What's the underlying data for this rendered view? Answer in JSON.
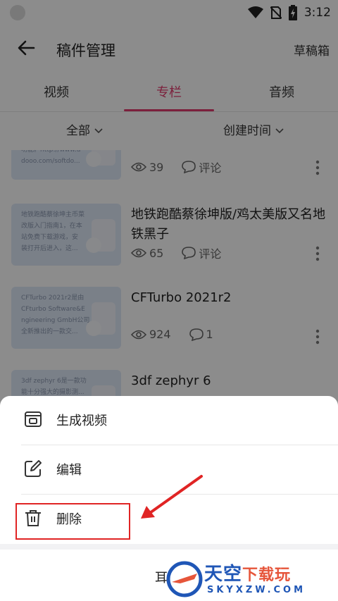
{
  "status_bar": {
    "time": "3:12"
  },
  "header": {
    "title": "稿件管理",
    "drafts_label": "草稿箱"
  },
  "tabs": [
    {
      "label": "视频",
      "active": false
    },
    {
      "label": "专栏",
      "active": true
    },
    {
      "label": "音频",
      "active": false
    }
  ],
  "filters": {
    "all_label": "全部",
    "sort_label": "创建时间"
  },
  "articles": [
    {
      "title": "",
      "thumb_text": "功能。http://www.d\ndooo.com/softdo...",
      "views": "39",
      "comments": "评论"
    },
    {
      "title": "地铁跑酷蔡徐坤版/鸡太美版又名地铁黑子",
      "thumb_text": "地铁跑酷蔡徐坤主币菜\n改版入门指南1，在本\n站免费下载游戏，安\n装打开后进入，这...",
      "views": "65",
      "comments": "评论"
    },
    {
      "title": "CFTurbo 2021r2",
      "thumb_text": "CFTurbo 2021r2是由\nCFturbo Software&E\nngineering GmbH公司\n全新推出的一款交...",
      "views": "924",
      "comments": "1"
    },
    {
      "title": "3df zephyr 6",
      "thumb_text": "3df zephyr 6是一款功\n能十分强大的摄影测...",
      "views": "",
      "comments": ""
    }
  ],
  "sheet": {
    "items": [
      {
        "label": "生成视频",
        "icon": "video-generate-icon"
      },
      {
        "label": "编辑",
        "icon": "edit-icon"
      },
      {
        "label": "删除",
        "icon": "trash-icon"
      }
    ],
    "cancel_partial": "耳"
  },
  "watermark": {
    "main": "天空",
    "sub": "下载玩",
    "domain": "SKYXZW.COM"
  },
  "colors": {
    "accent": "#e23b6d",
    "annotation": "#e02424",
    "watermark_blue": "#1f56b6",
    "watermark_orange": "#e6553a"
  }
}
